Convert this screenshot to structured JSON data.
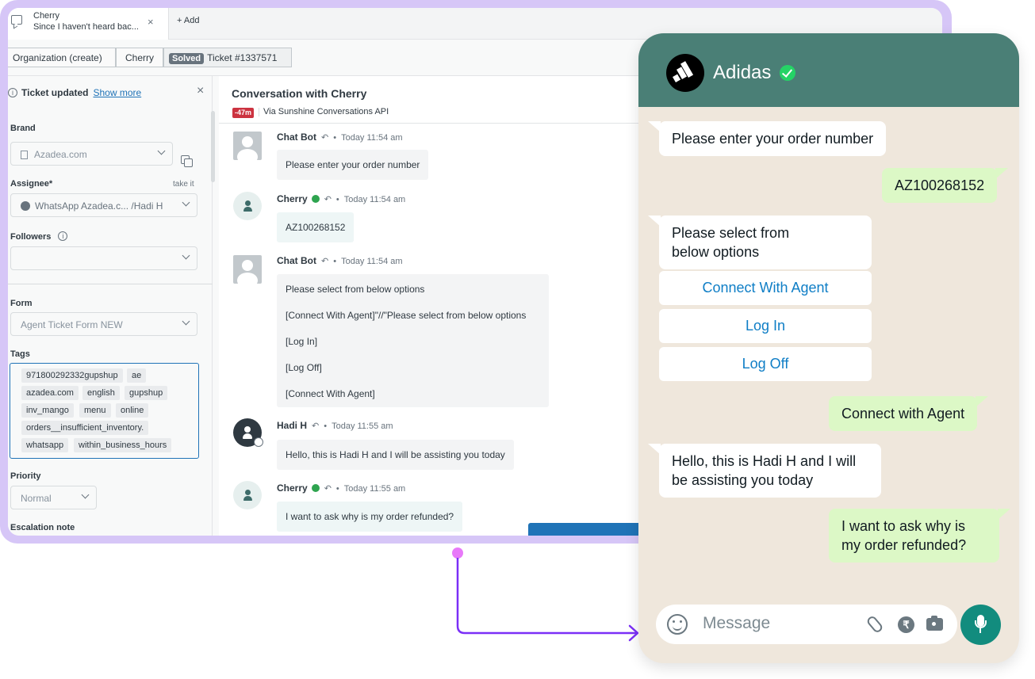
{
  "zendesk": {
    "tab": {
      "name": "Cherry",
      "preview": "Since I haven't heard bac...",
      "close": "×",
      "add_label": "+ Add"
    },
    "breadcrumbs": {
      "organization": "Organization (create)",
      "requester": "Cherry",
      "status": "Solved",
      "ticket": "Ticket #1337571"
    },
    "properties": {
      "notice": "Ticket updated",
      "show_more": "Show more",
      "close": "×",
      "brand_label": "Brand",
      "brand_value": "Azadea.com",
      "assignee_label": "Assignee*",
      "take_it": "take it",
      "assignee_value": "WhatsApp Azadea.c... /Hadi H",
      "followers_label": "Followers",
      "form_label": "Form",
      "form_value": "Agent Ticket Form NEW",
      "tags_label": "Tags",
      "tags": [
        "971800292332gupshup",
        "ae",
        "azadea.com",
        "english",
        "gupshup",
        "inv_mango",
        "menu",
        "online",
        "orders__insufficient_inventory.",
        "whatsapp",
        "within_business_hours"
      ],
      "priority_label": "Priority",
      "priority_value": "Normal",
      "escalation_label": "Escalation note"
    },
    "conversation": {
      "title": "Conversation with Cherry",
      "badge": "-47m",
      "via": "Via Sunshine Conversations API",
      "messages": [
        {
          "sender": "Chat Bot",
          "time": "Today 11:54 am",
          "lines": [
            "Please enter your order number"
          ]
        },
        {
          "sender": "Cherry",
          "time": "Today 11:54 am",
          "lines": [
            "AZ100268152"
          ]
        },
        {
          "sender": "Chat Bot",
          "time": "Today 11:54 am",
          "lines": [
            "Please select from below options",
            "[Connect With Agent]\"//\"Please select from below options",
            "[Log In]",
            "[Log Off]",
            "[Connect With Agent]"
          ]
        },
        {
          "sender": "Hadi H",
          "time": "Today 11:55 am",
          "lines": [
            "Hello, this is Hadi H and I will be assisting you today"
          ]
        },
        {
          "sender": "Cherry",
          "time": "Today 11:55 am",
          "lines": [
            "I want to ask why is my order refunded?"
          ]
        }
      ]
    }
  },
  "whatsapp": {
    "contact_name": "Adidas",
    "messages": [
      {
        "direction": "in",
        "text": "Please enter your order number"
      },
      {
        "direction": "out",
        "text": "AZ100268152"
      },
      {
        "direction": "in",
        "line1": "Please select from",
        "line2": "below options"
      },
      {
        "direction": "out",
        "text": "Connect with Agent"
      },
      {
        "direction": "in",
        "line1": "Hello, this is Hadi H and I will",
        "line2": "be assisting you today"
      },
      {
        "direction": "out",
        "line1": "I want to ask why is",
        "line2": "my order refunded?"
      }
    ],
    "quick_replies": [
      "Connect With Agent",
      "Log In",
      "Log Off"
    ],
    "input_placeholder": "Message",
    "rupee_symbol": "₹"
  },
  "colors": {
    "frame": "#d6c6f7",
    "wa_header": "#4a7f76",
    "wa_background": "#efe7dc",
    "wa_outgoing": "#dcf8c6",
    "wa_link": "#0f7ec6",
    "arrow": "#7b2ff7",
    "arrow_dot": "#e879f9"
  },
  "icons": [
    "chat-bubble-icon",
    "copy-icon",
    "info-icon",
    "chevron-down-icon",
    "reply-icon",
    "verified-icon",
    "emoji-icon",
    "attach-icon",
    "rupee-icon",
    "camera-icon",
    "mic-icon"
  ]
}
